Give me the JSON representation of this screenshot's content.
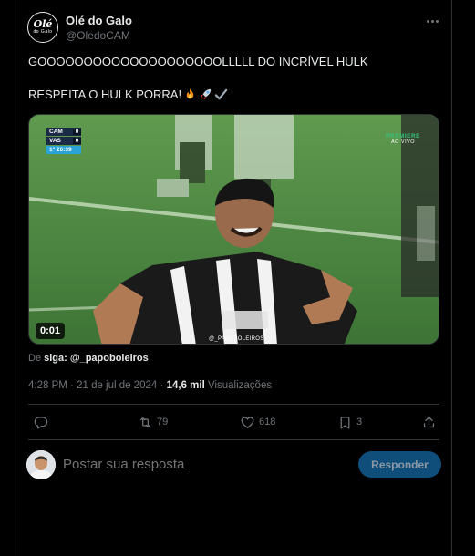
{
  "author": {
    "display_name": "Olé do Galo",
    "handle": "@OledoCAM",
    "avatar_logo": "Olé",
    "avatar_logo_sub": "do Galo"
  },
  "tweet": {
    "line1": "GOOOOOOOOOOOOOOOOOOOOLLLLL DO INCRÍVEL HULK",
    "line2": "RESPEITA O HULK PORRA!",
    "emojis": [
      "fire-emoji",
      "rocket-emoji",
      "check-mark-emoji"
    ]
  },
  "media": {
    "duration": "0:01",
    "scorebug": {
      "team1": "CAM",
      "score1": "0",
      "team2": "VAS",
      "score2": "0",
      "clock": "1° 26:39"
    },
    "broadcaster": "PREMIERE",
    "broadcaster_sub": "AO VIVO",
    "watermark": "@_PAPOBOLEIROS"
  },
  "attribution": {
    "prefix": "De",
    "source": "siga: @_papoboleiros"
  },
  "meta": {
    "time": "4:28 PM",
    "date": "21 de jul de 2024",
    "separator": "·",
    "views_count": "14,6 mil",
    "views_label": "Visualizações"
  },
  "actions": {
    "reply_icon": "reply-icon",
    "retweet_count": "79",
    "like_count": "618",
    "bookmark_count": "3",
    "share_icon": "share-icon"
  },
  "reply": {
    "placeholder": "Postar sua resposta",
    "button_label": "Responder"
  },
  "colors": {
    "background": "#000000",
    "text_primary": "#e7e9ea",
    "text_secondary": "#71767b",
    "border": "#2f3336",
    "button_disabled_bg": "#0f4e7a"
  }
}
